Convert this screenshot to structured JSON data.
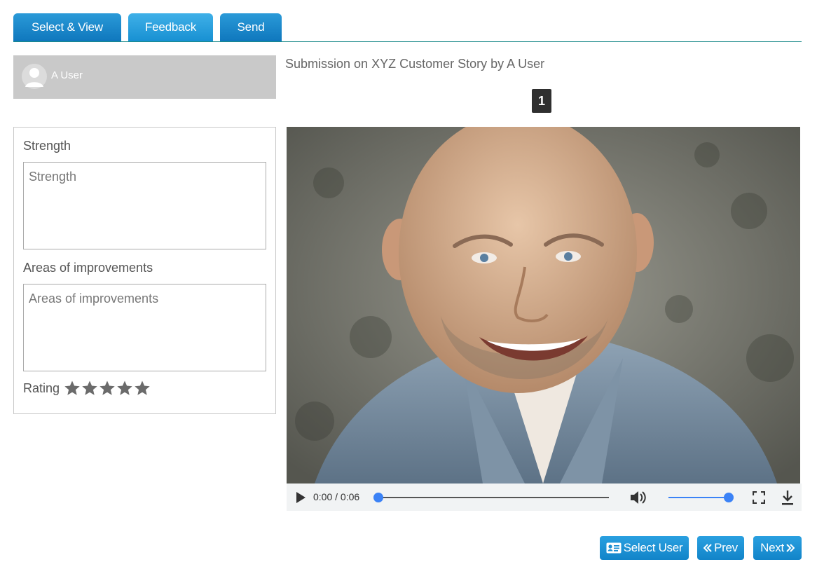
{
  "tabs": [
    {
      "label": "Select & View"
    },
    {
      "label": "Feedback",
      "active": true
    },
    {
      "label": "Send"
    }
  ],
  "user": {
    "name": "A User",
    "icon": "user-avatar-icon"
  },
  "submission": {
    "title": "Submission on XYZ Customer Story by A User",
    "page_number": "1"
  },
  "feedback": {
    "strength_label": "Strength",
    "strength_placeholder": "Strength",
    "areas_label": "Areas of improvements",
    "areas_placeholder": "Areas of improvements",
    "rating_label": "Rating",
    "rating_max": 5,
    "rating_value": 0
  },
  "media": {
    "time_display": "0:00 / 0:06",
    "progress": 0,
    "volume": 1.0,
    "icons": [
      "play-icon",
      "volume-icon",
      "fullscreen-icon",
      "download-icon"
    ]
  },
  "buttons": {
    "select_user": "Select User",
    "prev": "Prev",
    "next": "Next"
  },
  "colors": {
    "accent": "#1a8fd3",
    "tab_border": "#1a8a8a",
    "slider": "#3b82f6",
    "user_box": "#c9c9c9"
  }
}
